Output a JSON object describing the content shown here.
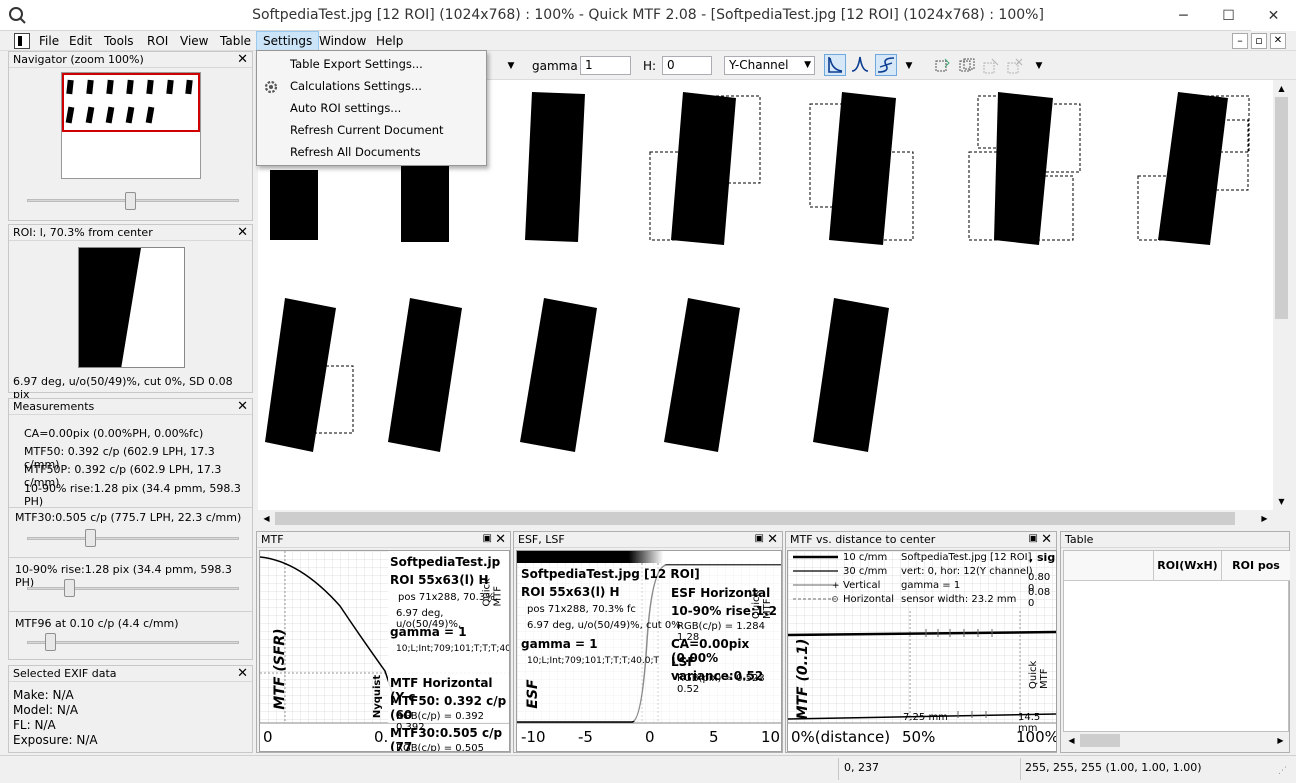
{
  "window": {
    "title": "SoftpediaTest.jpg [12 ROI] (1024x768) : 100% - Quick MTF 2.08 - [SoftpediaTest.jpg [12 ROI] (1024x768) : 100%]",
    "minimize": "─",
    "maximize": "☐",
    "close": "✕"
  },
  "menu": [
    "File",
    "Edit",
    "Tools",
    "ROI",
    "View",
    "Table",
    "Settings",
    "Window",
    "Help"
  ],
  "mdi_controls": [
    "–",
    "▫",
    "✕"
  ],
  "settings_menu": [
    "Table Export Settings...",
    "Calculations Settings...",
    "Auto ROI settings...",
    "Refresh Current Document",
    "Refresh All Documents"
  ],
  "toolbar": {
    "gamma_label": "gamma",
    "gamma_value": "1",
    "h_label": "H:",
    "h_value": "0",
    "channel": "Y-Channel"
  },
  "navigator": {
    "title": "Navigator (zoom 100%)"
  },
  "roi_panel": {
    "title": "ROI: l, 70.3% from center",
    "info": "6.97 deg, u/o(50/49)%, cut 0%, SD 0.08 pix"
  },
  "measurements": {
    "title": "Measurements",
    "lines": [
      "CA=0.00pix (0.00%PH, 0.00%fc)",
      "MTF50: 0.392 c/p (602.9 LPH, 17.3 c/mm)",
      "MTF50P: 0.392 c/p (602.9 LPH, 17.3 c/mm)",
      "10-90% rise:1.28 pix (34.4 pmm, 598.3 PH)"
    ],
    "slider1": "MTF30:0.505 c/p (775.7 LPH, 22.3 c/mm)",
    "slider2": "10-90% rise:1.28 pix (34.4 pmm, 598.3 PH)",
    "slider3": "MTF96 at 0.10 c/p (4.4 c/mm)"
  },
  "exif": {
    "title": "Selected EXIF data",
    "lines": [
      "Make: N/A",
      "Model: N/A",
      "FL: N/A",
      "Exposure: N/A"
    ]
  },
  "mtf_panel": {
    "title": "MTF",
    "ylabel": "MTF (SFR)",
    "nyquist": "Nyquist",
    "file": "SoftpediaTest.jp",
    "roi": "ROI 55x63(l) H",
    "pos": "pos 71x288, 70.3%,",
    "deg": "6.97 deg, u/o(50/49)%,",
    "gamma": "gamma = 1",
    "params": "10;L;Int;709;101;T;T;T;40",
    "horiz": "MTF Horizontal (Y c",
    "mtf50": "MTF50: 0.392 c/p (60",
    "rgb": "RGB(c/p) = 0.392 0.392",
    "mtf30": "MTF30:0.505 c/p (77",
    "rgb2": "RGB(c/p) = 0.505 0.50",
    "side": "Quick MTF",
    "x0": "0",
    "x1": "0."
  },
  "esf_panel": {
    "title": "ESF, LSF",
    "ylabel": "ESF",
    "file": "SoftpediaTest.jpg [12 ROI]",
    "roi": "ROI 55x63(l) H",
    "pos": "pos 71x288, 70.3% fc",
    "deg": "6.97 deg, u/o(50/49)%, cut 0%",
    "gamma": "gamma = 1",
    "params": "10;L;Int;709;101;T;T;T;40.0;T",
    "horiz": "ESF Horizontal",
    "rise": "10-90% rise:1.2",
    "rgb1": "RGB(c/p) = 1.284 1.28",
    "ca": "CA=0.00pix (0.00%",
    "lsf": "LSF variance:0.52",
    "rgb2": "RGB(pix) = 0.523 0.52",
    "side": "Quick MTF",
    "ticks": [
      "-10",
      "-5",
      "0",
      "5",
      "10"
    ]
  },
  "dist_panel": {
    "title": "MTF vs. distance to center",
    "ylabel": "MTF (0..1)",
    "legend": [
      "10 c/mm",
      "30 c/mm",
      "Vertical",
      "Horizontal"
    ],
    "file": "SoftpediaTest.jpg [12 ROI]",
    "sig": ", sig",
    "vh": "vert: 0, hor: 12(Y channel)",
    "gamma": "gamma = 1",
    "sensor": "sensor width: 23.2 mm",
    "n1": "0.80 0",
    "n2": "0.08 0",
    "a1": "7.25 mm",
    "a2": "14.5 mm",
    "side": "Quick MTF",
    "ticks": [
      "0%(distance)",
      "50%",
      "100%"
    ]
  },
  "table_panel": {
    "title": "Table",
    "cols": [
      "ROI(WxH)",
      "ROI pos"
    ]
  },
  "status": {
    "coords": "0, 237",
    "rgb": "255, 255, 255 (1.00, 1.00, 1.00)"
  },
  "chart_data": [
    {
      "type": "line",
      "title": "MTF",
      "ylabel": "MTF (SFR)",
      "series": [
        {
          "x": [
            0,
            0.1,
            0.2,
            0.3,
            0.4,
            0.5
          ],
          "values": [
            1.0,
            0.97,
            0.86,
            0.69,
            0.5,
            0.33
          ]
        }
      ],
      "ylim": [
        0,
        1
      ]
    },
    {
      "type": "line",
      "title": "ESF, LSF",
      "ylabel": "ESF",
      "x": [
        -10,
        -5,
        0,
        5,
        10
      ],
      "xlim": [
        -10,
        10
      ]
    },
    {
      "type": "line",
      "title": "MTF vs. distance to center",
      "ylabel": "MTF (0..1)",
      "series": [
        {
          "name": "10 c/mm",
          "values": [
            0.95,
            0.96
          ]
        },
        {
          "name": "30 c/mm",
          "values": [
            0.1,
            0.1
          ]
        }
      ]
    }
  ]
}
